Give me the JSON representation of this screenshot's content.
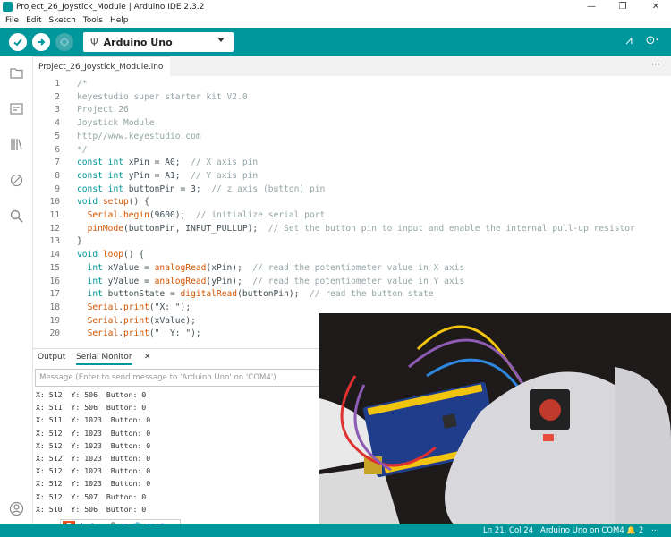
{
  "window": {
    "title": "Project_26_Joystick_Module | Arduino IDE 2.3.2",
    "minimize": "—",
    "restore": "❐",
    "close": "✕"
  },
  "menu": [
    "File",
    "Edit",
    "Sketch",
    "Tools",
    "Help"
  ],
  "toolbar": {
    "board": "Arduino Uno",
    "usb_glyph": "Ψ",
    "plotter_glyph": "⩘",
    "monitor_glyph": "⊙·"
  },
  "tab": {
    "name": "Project_26_Joystick_Module.ino",
    "more": "⋯"
  },
  "code": [
    {
      "n": "1",
      "parts": [
        [
          "cm",
          "/*"
        ]
      ]
    },
    {
      "n": "2",
      "parts": [
        [
          "cm",
          "keyestudio super starter kit V2.0"
        ]
      ]
    },
    {
      "n": "3",
      "parts": [
        [
          "cm",
          "Project 26"
        ]
      ]
    },
    {
      "n": "4",
      "parts": [
        [
          "cm",
          "Joystick Module"
        ]
      ]
    },
    {
      "n": "5",
      "parts": [
        [
          "cm",
          "http//www.keyestudio.com"
        ]
      ]
    },
    {
      "n": "6",
      "parts": [
        [
          "cm",
          "*/"
        ]
      ]
    },
    {
      "n": "7",
      "parts": [
        [
          "kw",
          "const"
        ],
        [
          "",
          " "
        ],
        [
          "kw",
          "int"
        ],
        [
          "",
          " xPin = A0;  "
        ],
        [
          "cm",
          "// X axis pin"
        ]
      ]
    },
    {
      "n": "8",
      "parts": [
        [
          "kw",
          "const"
        ],
        [
          "",
          " "
        ],
        [
          "kw",
          "int"
        ],
        [
          "",
          " yPin = A1;  "
        ],
        [
          "cm",
          "// Y axis pin"
        ]
      ]
    },
    {
      "n": "9",
      "parts": [
        [
          "kw",
          "const"
        ],
        [
          "",
          " "
        ],
        [
          "kw",
          "int"
        ],
        [
          "",
          " buttonPin = 3;  "
        ],
        [
          "cm",
          "// z axis (button) pin"
        ]
      ]
    },
    {
      "n": "10",
      "parts": [
        [
          "kw",
          "void"
        ],
        [
          "",
          " "
        ],
        [
          "fn",
          "setup"
        ],
        [
          "",
          "() {"
        ]
      ]
    },
    {
      "n": "11",
      "parts": [
        [
          "",
          "  "
        ],
        [
          "fn",
          "Serial"
        ],
        [
          "",
          "."
        ],
        [
          "fn",
          "begin"
        ],
        [
          "",
          "(9600);  "
        ],
        [
          "cm",
          "// initialize serial port"
        ]
      ]
    },
    {
      "n": "12",
      "parts": [
        [
          "",
          "  "
        ],
        [
          "fn",
          "pinMode"
        ],
        [
          "",
          "(buttonPin, INPUT_PULLUP);  "
        ],
        [
          "cm",
          "// Set the button pin to input and enable the internal pull-up resistor"
        ]
      ]
    },
    {
      "n": "13",
      "parts": [
        [
          "",
          "}"
        ]
      ]
    },
    {
      "n": "14",
      "parts": [
        [
          "kw",
          "void"
        ],
        [
          "",
          " "
        ],
        [
          "fn",
          "loop"
        ],
        [
          "",
          "() {"
        ]
      ]
    },
    {
      "n": "15",
      "parts": [
        [
          "",
          "  "
        ],
        [
          "kw",
          "int"
        ],
        [
          "",
          " xValue = "
        ],
        [
          "fn",
          "analogRead"
        ],
        [
          "",
          "(xPin);  "
        ],
        [
          "cm",
          "// read the potentiometer value in X axis"
        ]
      ]
    },
    {
      "n": "16",
      "parts": [
        [
          "",
          "  "
        ],
        [
          "kw",
          "int"
        ],
        [
          "",
          " yValue = "
        ],
        [
          "fn",
          "analogRead"
        ],
        [
          "",
          "(yPin);  "
        ],
        [
          "cm",
          "// read the potentiometer value in Y axis"
        ]
      ]
    },
    {
      "n": "17",
      "parts": [
        [
          "",
          "  "
        ],
        [
          "kw",
          "int"
        ],
        [
          "",
          " buttonState = "
        ],
        [
          "fn",
          "digitalRead"
        ],
        [
          "",
          "(buttonPin);  "
        ],
        [
          "cm",
          "// read the button state"
        ]
      ]
    },
    {
      "n": "18",
      "parts": [
        [
          "",
          "  "
        ],
        [
          "fn",
          "Serial"
        ],
        [
          "",
          "."
        ],
        [
          "fn",
          "print"
        ],
        [
          "",
          "(\"X: \");"
        ]
      ]
    },
    {
      "n": "19",
      "parts": [
        [
          "",
          "  "
        ],
        [
          "fn",
          "Serial"
        ],
        [
          "",
          "."
        ],
        [
          "fn",
          "print"
        ],
        [
          "",
          "(xValue);"
        ]
      ]
    },
    {
      "n": "20",
      "parts": [
        [
          "",
          "  "
        ],
        [
          "fn",
          "Serial"
        ],
        [
          "",
          "."
        ],
        [
          "fn",
          "print"
        ],
        [
          "",
          "(\"  Y: \");"
        ]
      ]
    }
  ],
  "panel": {
    "output_tab": "Output",
    "serial_tab": "Serial Monitor",
    "close": "✕",
    "message_placeholder": "Message (Enter to send message to 'Arduino Uno' on 'COM4')"
  },
  "serial_lines": [
    "X: 512  Y: 506  Button: 0",
    "X: 511  Y: 506  Button: 0",
    "X: 511  Y: 1023  Button: 0",
    "X: 512  Y: 1023  Button: 0",
    "X: 512  Y: 1023  Button: 0",
    "X: 512  Y: 1023  Button: 0",
    "X: 512  Y: 1023  Button: 0",
    "X: 512  Y: 1023  Button: 0",
    "X: 512  Y: 507  Button: 0",
    "X: 510  Y: 506  Button: 0"
  ],
  "status": {
    "position": "Ln 21, Col 24",
    "board_port": "Arduino Uno on COM4",
    "notifications": "2",
    "bell": "🔔"
  },
  "ime": {
    "logo": "S",
    "items": [
      "中",
      "°",
      ",",
      "🎤",
      "▦",
      "👕",
      "▦",
      "⚙"
    ]
  },
  "colors": {
    "accent": "#00979c",
    "keyword": "#00979c",
    "function": "#d35400",
    "comment": "#95a5a6"
  }
}
